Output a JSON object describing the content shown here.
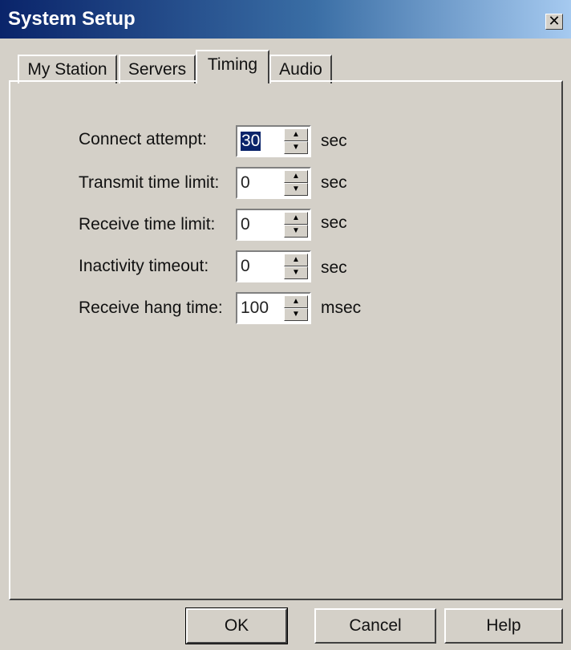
{
  "window": {
    "title": "System Setup",
    "close_glyph": "✕"
  },
  "tabs": [
    {
      "label": "My Station",
      "active": false
    },
    {
      "label": "Servers",
      "active": false
    },
    {
      "label": "Timing",
      "active": true
    },
    {
      "label": "Audio",
      "active": false
    }
  ],
  "fields": [
    {
      "label": "Connect attempt:",
      "value": "30",
      "unit": "sec",
      "selected": true
    },
    {
      "label": "Transmit time limit:",
      "value": "0",
      "unit": "sec",
      "selected": false
    },
    {
      "label": "Receive time limit:",
      "value": "0",
      "unit": "sec",
      "selected": false
    },
    {
      "label": "Inactivity timeout:",
      "value": "0",
      "unit": "sec",
      "selected": false
    },
    {
      "label": "Receive hang time:",
      "value": "100",
      "unit": "msec",
      "selected": false
    }
  ],
  "spin": {
    "up_icon": "▲",
    "down_icon": "▼"
  },
  "buttons": {
    "ok": "OK",
    "cancel": "Cancel",
    "help": "Help"
  },
  "colors": {
    "titlebar_start": "#0a246a",
    "face": "#d4d0c8",
    "selection": "#0a246a"
  }
}
